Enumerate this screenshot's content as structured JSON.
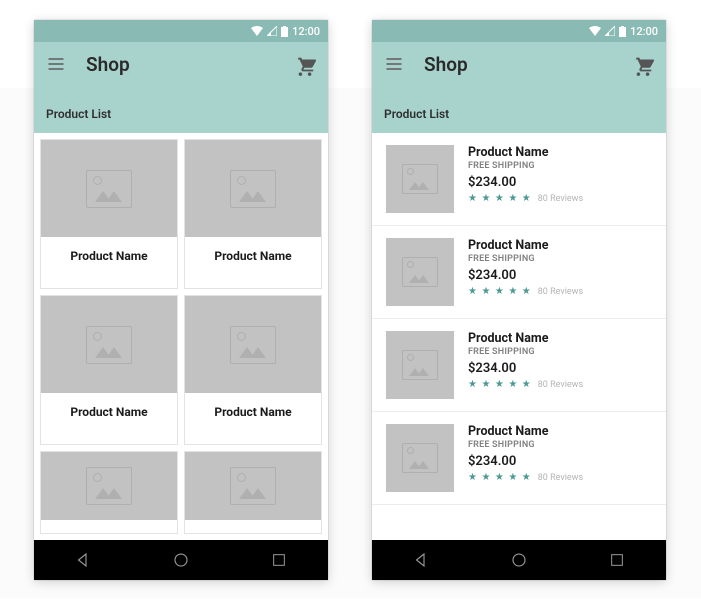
{
  "status": {
    "time": "12:00"
  },
  "header": {
    "title": "Shop",
    "subheader": "Product List"
  },
  "grid": {
    "items": [
      {
        "name": "Product Name"
      },
      {
        "name": "Product Name"
      },
      {
        "name": "Product Name"
      },
      {
        "name": "Product Name"
      }
    ]
  },
  "list": {
    "items": [
      {
        "name": "Product Name",
        "shipping": "FREE SHIPPING",
        "price": "$234.00",
        "reviews": "80 Reviews"
      },
      {
        "name": "Product Name",
        "shipping": "FREE SHIPPING",
        "price": "$234.00",
        "reviews": "80 Reviews"
      },
      {
        "name": "Product Name",
        "shipping": "FREE SHIPPING",
        "price": "$234.00",
        "reviews": "80 Reviews"
      },
      {
        "name": "Product Name",
        "shipping": "FREE SHIPPING",
        "price": "$234.00",
        "reviews": "80 Reviews"
      }
    ]
  }
}
